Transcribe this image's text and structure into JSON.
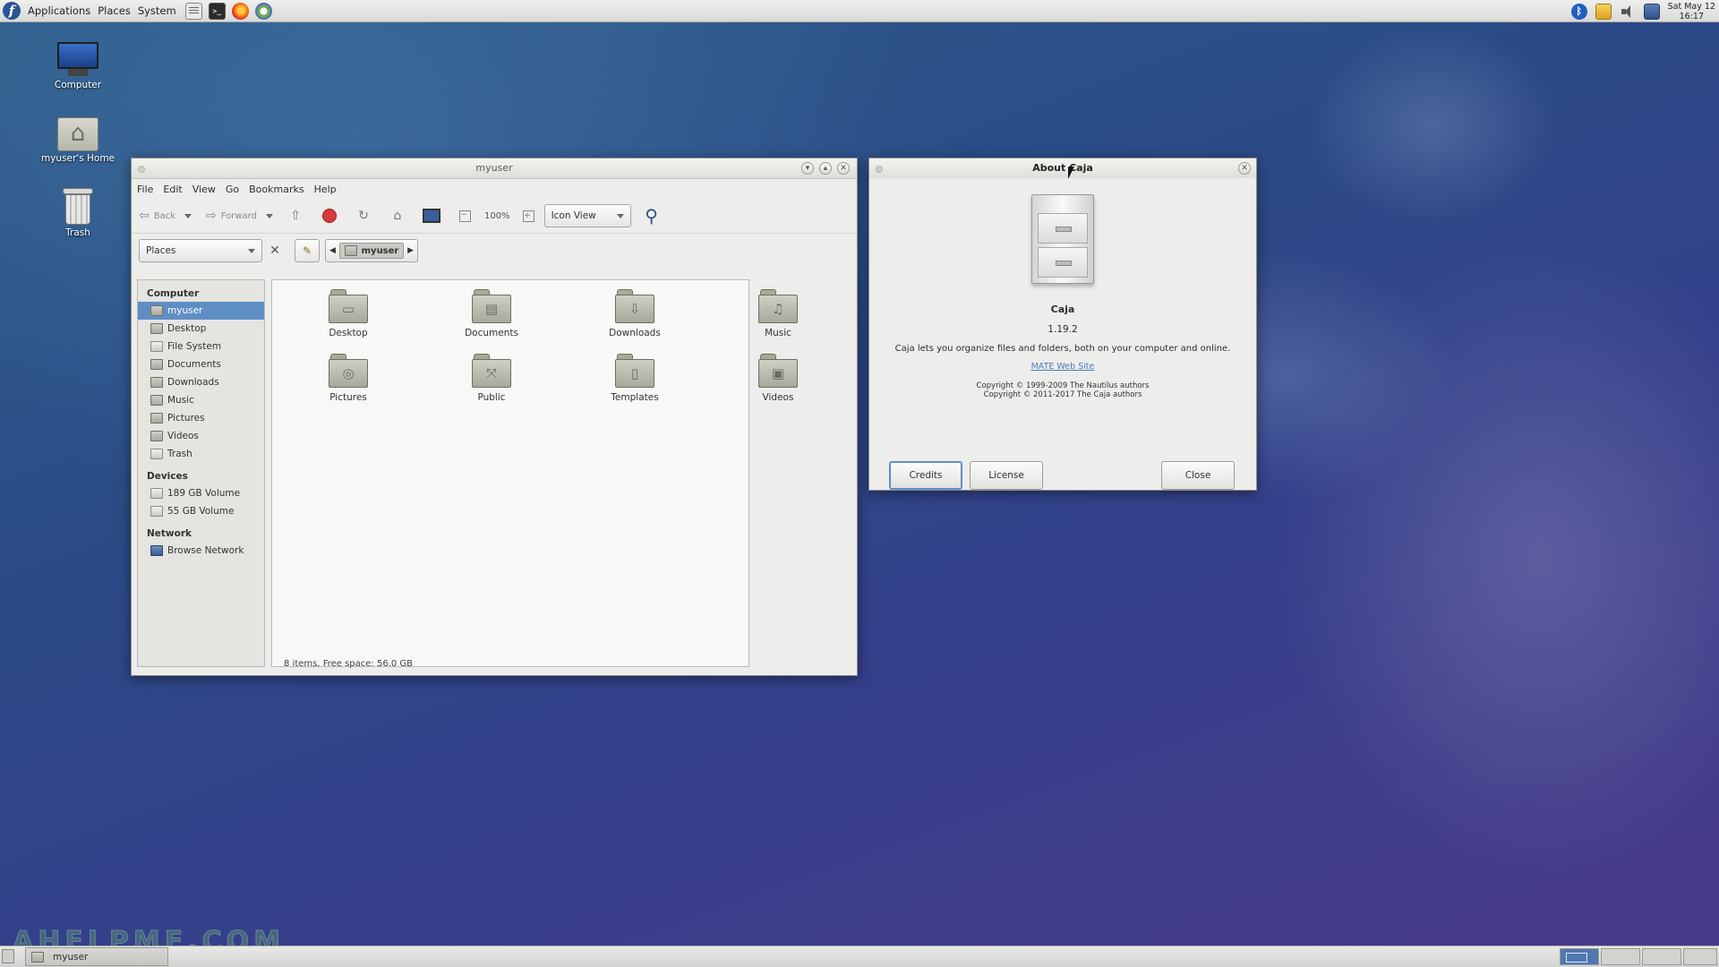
{
  "top_panel": {
    "menus": [
      "Applications",
      "Places",
      "System"
    ],
    "launchers": [
      "files-icon",
      "terminal-icon",
      "firefox-icon",
      "software-icon"
    ],
    "clock": {
      "date": "Sat May 12",
      "time": "16:17"
    }
  },
  "desktop": {
    "icons": [
      {
        "label": "Computer"
      },
      {
        "label": "myuser's Home"
      },
      {
        "label": "Trash"
      }
    ]
  },
  "file_manager": {
    "title": "myuser",
    "menu": [
      "File",
      "Edit",
      "View",
      "Go",
      "Bookmarks",
      "Help"
    ],
    "toolbar": {
      "back": "Back",
      "forward": "Forward",
      "zoom": "100%",
      "view_mode": "Icon View"
    },
    "sidebar_selector": "Places",
    "breadcrumb": "myuser",
    "sidebar": {
      "computer_heading": "Computer",
      "computer_items": [
        "myuser",
        "Desktop",
        "File System",
        "Documents",
        "Downloads",
        "Music",
        "Pictures",
        "Videos",
        "Trash"
      ],
      "devices_heading": "Devices",
      "devices_items": [
        "189 GB Volume",
        "55 GB Volume"
      ],
      "network_heading": "Network",
      "network_items": [
        "Browse Network"
      ]
    },
    "folders": [
      "Desktop",
      "Documents",
      "Downloads",
      "Music",
      "Pictures",
      "Public",
      "Templates",
      "Videos"
    ],
    "status": "8 items, Free space: 56.0 GB"
  },
  "about_dialog": {
    "title": "About Caja",
    "name": "Caja",
    "version": "1.19.2",
    "description": "Caja lets you organize files and folders, both on your computer and online.",
    "link": "MATE Web Site",
    "copyright": [
      "Copyright © 1999-2009 The Nautilus authors",
      "Copyright © 2011-2017 The Caja authors"
    ],
    "buttons": {
      "credits": "Credits",
      "license": "License",
      "close": "Close"
    }
  },
  "bottom_panel": {
    "task": "myuser"
  },
  "watermark": "AHELPME.COM",
  "colors": {
    "selection": "#5f8ec5",
    "link": "#4b7bc4"
  }
}
